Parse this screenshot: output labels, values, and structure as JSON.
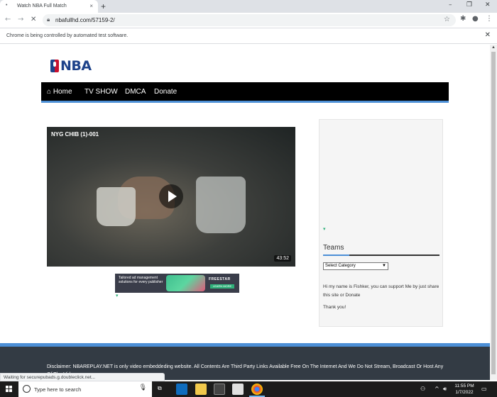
{
  "browser": {
    "tab_title": "Watch NBA Full Match",
    "tab_close": "×",
    "new_tab": "+",
    "url": "nbafullhd.com/57159-2/",
    "automation_notice": "Chrome is being controlled by automated test software.",
    "notice_close": "✕",
    "status_text": "Waiting for securepubads.g.doubleclick.net..."
  },
  "site": {
    "logo_text": "NBA",
    "menu": [
      {
        "label": "Home",
        "icon": "home-icon"
      },
      {
        "label": "TV SHOW"
      },
      {
        "label": "DMCA"
      },
      {
        "label": "Donate"
      }
    ],
    "video": {
      "title": "NYG CHIB (1)-001",
      "duration": "43:52"
    },
    "ad": {
      "text": "Tailored ad management solutions for every publisher",
      "brand": "FREESTAR",
      "cta": "LEARN MORE"
    },
    "sidebar": {
      "teams_heading": "Teams",
      "select_value": "Select Category",
      "about_text": "Hi my name is Fishker, you can support Me by just share this site or Donate",
      "thanks_text": "Thank you!"
    },
    "footer": {
      "disclaimer": "Disclaimer: NBAREPLAY.NET is only video embeddeding website. All Contents Are Third Party Links Available Free On The Internet And We Do Not Stream, Broadcast Or Host Any Of The Videos."
    }
  },
  "taskbar": {
    "search_placeholder": "Type here to search",
    "time": "11:55 PM",
    "date": "1/7/2022"
  },
  "colors": {
    "accent_blue": "#4c8fd6",
    "menu_bg": "#000000",
    "footer_bg": "#333b44",
    "nba_blue": "#1d428a",
    "nba_red": "#c8102e"
  }
}
